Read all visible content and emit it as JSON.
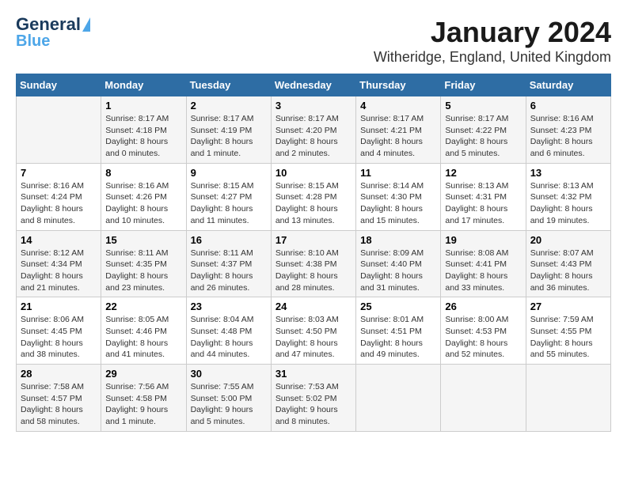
{
  "logo": {
    "line1": "General",
    "line2": "Blue"
  },
  "header": {
    "month_year": "January 2024",
    "location": "Witheridge, England, United Kingdom"
  },
  "days_of_week": [
    "Sunday",
    "Monday",
    "Tuesday",
    "Wednesday",
    "Thursday",
    "Friday",
    "Saturday"
  ],
  "weeks": [
    [
      {
        "num": "",
        "info": ""
      },
      {
        "num": "1",
        "info": "Sunrise: 8:17 AM\nSunset: 4:18 PM\nDaylight: 8 hours\nand 0 minutes."
      },
      {
        "num": "2",
        "info": "Sunrise: 8:17 AM\nSunset: 4:19 PM\nDaylight: 8 hours\nand 1 minute."
      },
      {
        "num": "3",
        "info": "Sunrise: 8:17 AM\nSunset: 4:20 PM\nDaylight: 8 hours\nand 2 minutes."
      },
      {
        "num": "4",
        "info": "Sunrise: 8:17 AM\nSunset: 4:21 PM\nDaylight: 8 hours\nand 4 minutes."
      },
      {
        "num": "5",
        "info": "Sunrise: 8:17 AM\nSunset: 4:22 PM\nDaylight: 8 hours\nand 5 minutes."
      },
      {
        "num": "6",
        "info": "Sunrise: 8:16 AM\nSunset: 4:23 PM\nDaylight: 8 hours\nand 6 minutes."
      }
    ],
    [
      {
        "num": "7",
        "info": "Sunrise: 8:16 AM\nSunset: 4:24 PM\nDaylight: 8 hours\nand 8 minutes."
      },
      {
        "num": "8",
        "info": "Sunrise: 8:16 AM\nSunset: 4:26 PM\nDaylight: 8 hours\nand 10 minutes."
      },
      {
        "num": "9",
        "info": "Sunrise: 8:15 AM\nSunset: 4:27 PM\nDaylight: 8 hours\nand 11 minutes."
      },
      {
        "num": "10",
        "info": "Sunrise: 8:15 AM\nSunset: 4:28 PM\nDaylight: 8 hours\nand 13 minutes."
      },
      {
        "num": "11",
        "info": "Sunrise: 8:14 AM\nSunset: 4:30 PM\nDaylight: 8 hours\nand 15 minutes."
      },
      {
        "num": "12",
        "info": "Sunrise: 8:13 AM\nSunset: 4:31 PM\nDaylight: 8 hours\nand 17 minutes."
      },
      {
        "num": "13",
        "info": "Sunrise: 8:13 AM\nSunset: 4:32 PM\nDaylight: 8 hours\nand 19 minutes."
      }
    ],
    [
      {
        "num": "14",
        "info": "Sunrise: 8:12 AM\nSunset: 4:34 PM\nDaylight: 8 hours\nand 21 minutes."
      },
      {
        "num": "15",
        "info": "Sunrise: 8:11 AM\nSunset: 4:35 PM\nDaylight: 8 hours\nand 23 minutes."
      },
      {
        "num": "16",
        "info": "Sunrise: 8:11 AM\nSunset: 4:37 PM\nDaylight: 8 hours\nand 26 minutes."
      },
      {
        "num": "17",
        "info": "Sunrise: 8:10 AM\nSunset: 4:38 PM\nDaylight: 8 hours\nand 28 minutes."
      },
      {
        "num": "18",
        "info": "Sunrise: 8:09 AM\nSunset: 4:40 PM\nDaylight: 8 hours\nand 31 minutes."
      },
      {
        "num": "19",
        "info": "Sunrise: 8:08 AM\nSunset: 4:41 PM\nDaylight: 8 hours\nand 33 minutes."
      },
      {
        "num": "20",
        "info": "Sunrise: 8:07 AM\nSunset: 4:43 PM\nDaylight: 8 hours\nand 36 minutes."
      }
    ],
    [
      {
        "num": "21",
        "info": "Sunrise: 8:06 AM\nSunset: 4:45 PM\nDaylight: 8 hours\nand 38 minutes."
      },
      {
        "num": "22",
        "info": "Sunrise: 8:05 AM\nSunset: 4:46 PM\nDaylight: 8 hours\nand 41 minutes."
      },
      {
        "num": "23",
        "info": "Sunrise: 8:04 AM\nSunset: 4:48 PM\nDaylight: 8 hours\nand 44 minutes."
      },
      {
        "num": "24",
        "info": "Sunrise: 8:03 AM\nSunset: 4:50 PM\nDaylight: 8 hours\nand 47 minutes."
      },
      {
        "num": "25",
        "info": "Sunrise: 8:01 AM\nSunset: 4:51 PM\nDaylight: 8 hours\nand 49 minutes."
      },
      {
        "num": "26",
        "info": "Sunrise: 8:00 AM\nSunset: 4:53 PM\nDaylight: 8 hours\nand 52 minutes."
      },
      {
        "num": "27",
        "info": "Sunrise: 7:59 AM\nSunset: 4:55 PM\nDaylight: 8 hours\nand 55 minutes."
      }
    ],
    [
      {
        "num": "28",
        "info": "Sunrise: 7:58 AM\nSunset: 4:57 PM\nDaylight: 8 hours\nand 58 minutes."
      },
      {
        "num": "29",
        "info": "Sunrise: 7:56 AM\nSunset: 4:58 PM\nDaylight: 9 hours\nand 1 minute."
      },
      {
        "num": "30",
        "info": "Sunrise: 7:55 AM\nSunset: 5:00 PM\nDaylight: 9 hours\nand 5 minutes."
      },
      {
        "num": "31",
        "info": "Sunrise: 7:53 AM\nSunset: 5:02 PM\nDaylight: 9 hours\nand 8 minutes."
      },
      {
        "num": "",
        "info": ""
      },
      {
        "num": "",
        "info": ""
      },
      {
        "num": "",
        "info": ""
      }
    ]
  ]
}
